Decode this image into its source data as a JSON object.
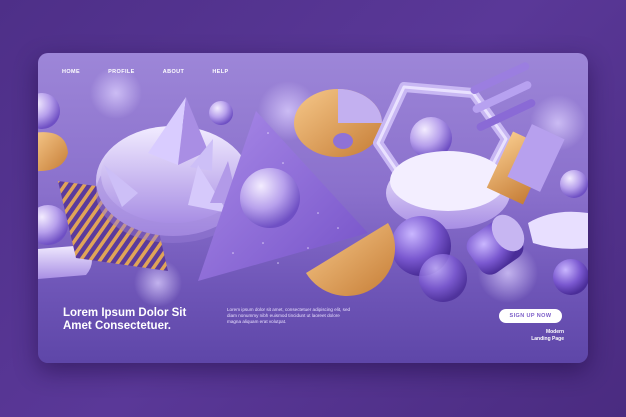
{
  "nav": {
    "items": [
      {
        "label": "HOME"
      },
      {
        "label": "PROFILE"
      },
      {
        "label": "ABOUT"
      },
      {
        "label": "HELP"
      }
    ]
  },
  "hero": {
    "headline_line1": "Lorem Ipsum Dolor Sit",
    "headline_line2": "Amet Consectetuer.",
    "body_line1": "Lorem ipsum dolor sit amet, consectetuer adipiscing elit, sed",
    "body_line2": "diam nonummy nibh euismod tincidunt ut laoreet dolore",
    "body_line3": "magna aliquam erat volutpat."
  },
  "cta": {
    "label": "SIGN UP NOW"
  },
  "tagline": {
    "line1": "Modern",
    "line2": "Landing Page"
  },
  "colors": {
    "background": "#4e2f88",
    "card_top": "#9d86d8",
    "card_bottom": "#5e46a8",
    "accent_gold": "#e0a458",
    "shape_lilac": "#c7b6f2",
    "shape_violet": "#7a58d0"
  }
}
